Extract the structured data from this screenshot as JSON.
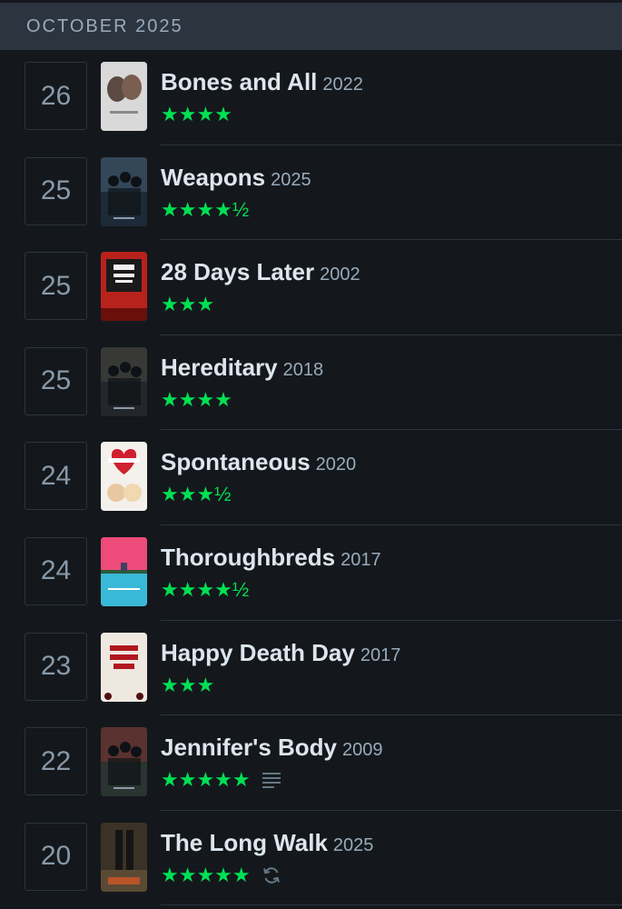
{
  "month_header": "OCTOBER 2025",
  "accent_color": "#00e054",
  "entries": [
    {
      "day": "26",
      "title": "Bones and All",
      "year": "2022",
      "rating": "★★★★",
      "icon": null,
      "poster": {
        "bg": "#d9d9d9",
        "accent": "#5a4a42",
        "kind": "faces-light"
      }
    },
    {
      "day": "25",
      "title": "Weapons",
      "year": "2025",
      "rating": "★★★★½",
      "icon": null,
      "poster": {
        "bg": "#1d2a38",
        "accent": "#4a6378",
        "kind": "dark-figures"
      }
    },
    {
      "day": "25",
      "title": "28 Days Later",
      "year": "2002",
      "rating": "★★★",
      "icon": null,
      "poster": {
        "bg": "#b8221c",
        "accent": "#1a1a1a",
        "kind": "red-bold"
      }
    },
    {
      "day": "25",
      "title": "Hereditary",
      "year": "2018",
      "rating": "★★★★",
      "icon": null,
      "poster": {
        "bg": "#23262a",
        "accent": "#4e4a44",
        "kind": "dark-figures"
      }
    },
    {
      "day": "24",
      "title": "Spontaneous",
      "year": "2020",
      "rating": "★★★½",
      "icon": null,
      "poster": {
        "bg": "#f4f0ec",
        "accent": "#d02030",
        "kind": "heart"
      }
    },
    {
      "day": "24",
      "title": "Thoroughbreds",
      "year": "2017",
      "rating": "★★★★½",
      "icon": null,
      "poster": {
        "bg": "#ee4a7a",
        "accent": "#3ab8d8",
        "kind": "split"
      }
    },
    {
      "day": "23",
      "title": "Happy Death Day",
      "year": "2017",
      "rating": "★★★",
      "icon": null,
      "poster": {
        "bg": "#efe8e0",
        "accent": "#b01820",
        "kind": "text-red"
      }
    },
    {
      "day": "22",
      "title": "Jennifer's Body",
      "year": "2009",
      "rating": "★★★★★",
      "icon": "review-lines-icon",
      "poster": {
        "bg": "#2a3430",
        "accent": "#8a3030",
        "kind": "dark-figures"
      }
    },
    {
      "day": "20",
      "title": "The Long Walk",
      "year": "2025",
      "rating": "★★★★★",
      "icon": "rewatch-icon",
      "poster": {
        "bg": "#3a3226",
        "accent": "#b8542a",
        "kind": "walk"
      }
    }
  ]
}
